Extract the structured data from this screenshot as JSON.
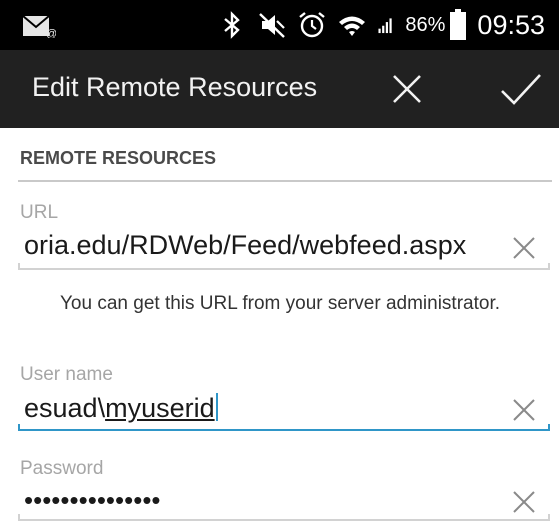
{
  "status_bar": {
    "battery_percent": "86%",
    "time": "09:53",
    "icons": [
      "gmail-notification-icon",
      "bluetooth-icon",
      "mute-icon",
      "alarm-icon",
      "wifi-icon",
      "signal-icon",
      "battery-icon"
    ]
  },
  "action_bar": {
    "title": "Edit Remote Resources",
    "close_icon": "close-icon",
    "done_icon": "check-icon"
  },
  "form": {
    "section_title": "REMOTE RESOURCES",
    "url": {
      "label": "URL",
      "value": "oria.edu/RDWeb/Feed/webfeed.aspx"
    },
    "url_help": "You can get this URL from your server administrator.",
    "username": {
      "label": "User name",
      "value_prefix": "esuad\\",
      "value_underlined": "myuserid"
    },
    "password": {
      "label": "Password",
      "value": "•••••••••••••••"
    }
  },
  "colors": {
    "status_bar_bg": "#000000",
    "action_bar_bg": "#212121",
    "focus_accent": "#2f96c8"
  }
}
